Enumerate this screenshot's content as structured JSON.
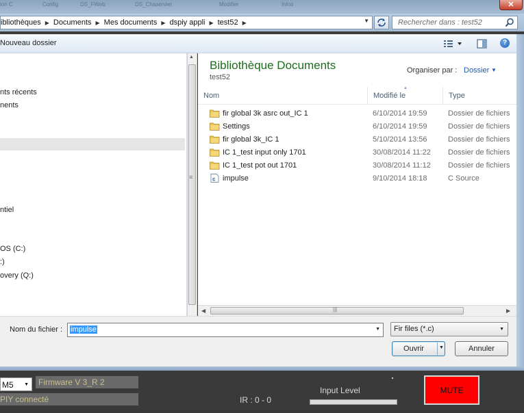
{
  "window": {
    "close_glyph": "✕",
    "ghost_tabs": [
      "ion C",
      "Config",
      "DS_FWeb",
      "DS_Chaservier",
      "Modifier",
      "Infos"
    ]
  },
  "address": {
    "crumbs": [
      "ibliothèques",
      "Documents",
      "Mes documents",
      "dspiy appli",
      "test52"
    ],
    "search_placeholder": "Rechercher dans : test52"
  },
  "toolbar": {
    "new_folder": "Nouveau dossier",
    "help_glyph": "?"
  },
  "nav": {
    "items": [
      {
        "label": "nts récents"
      },
      {
        "label": "nents"
      },
      {
        "label": "ntiel"
      },
      {
        "label": "OS (C:)"
      },
      {
        "label": ":)"
      },
      {
        "label": "overy (Q:)"
      }
    ]
  },
  "library": {
    "title": "Bibliothèque Documents",
    "subtitle": "test52",
    "arrange_label": "Organiser par :",
    "arrange_value": "Dossier"
  },
  "columns": {
    "name": "Nom",
    "modified": "Modifié le",
    "type": "Type"
  },
  "files": [
    {
      "name": "fir global 3k asrc out_IC 1",
      "date": "6/10/2014 19:59",
      "type": "Dossier de fichiers",
      "icon": "folder-icon"
    },
    {
      "name": "Settings",
      "date": "6/10/2014 19:59",
      "type": "Dossier de fichiers",
      "icon": "folder-icon"
    },
    {
      "name": "fir global 3k_IC 1",
      "date": "5/10/2014 13:56",
      "type": "Dossier de fichiers",
      "icon": "folder-icon"
    },
    {
      "name": "IC 1_test input only 1701",
      "date": "30/08/2014 11:22",
      "type": "Dossier de fichiers",
      "icon": "folder-icon"
    },
    {
      "name": "IC 1_test pot out 1701",
      "date": "30/08/2014 11:12",
      "type": "Dossier de fichiers",
      "icon": "folder-icon"
    },
    {
      "name": "impulse",
      "date": "9/10/2014 18:18",
      "type": "C Source",
      "icon": "c-source-file-icon"
    }
  ],
  "bottom": {
    "filename_label": "Nom du fichier :",
    "filename_value": "impulse",
    "filter": "Fir files (*.c)",
    "open_label": "Ouvrir",
    "cancel_label": "Annuler"
  },
  "app": {
    "port": "M5",
    "firmware": "Firmware V 3_R 2",
    "connection": "PIY connecté",
    "ir": "IR : 0 - 0",
    "input_level_label": "Input Level",
    "mute_label": "MUTE"
  },
  "colors": {
    "library_title": "#1e6c1e",
    "link_blue": "#1d5bb8",
    "selection_blue": "#3399ff",
    "mute_red": "#ff0000",
    "firmware_text": "#c9c08a"
  }
}
